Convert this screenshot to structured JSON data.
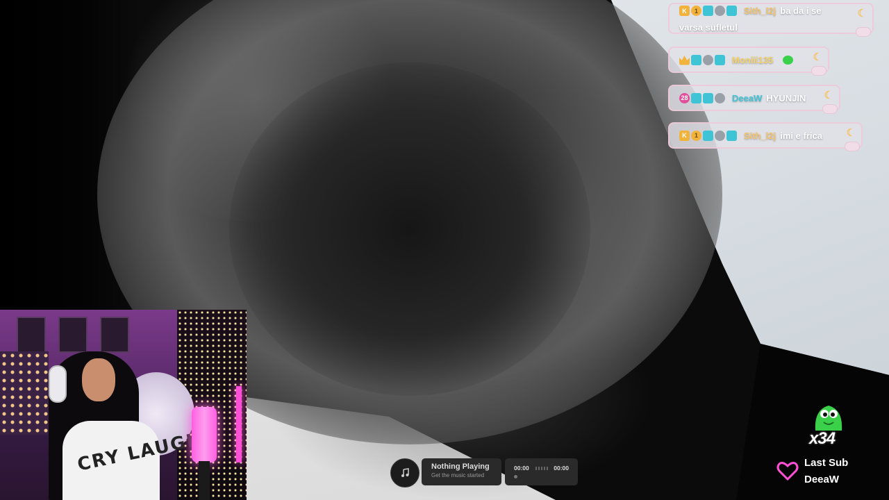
{
  "chat": {
    "messages": [
      {
        "user": "Sith_l2j",
        "text": "ba da i se",
        "text2": "varsa sufletul",
        "name_color": "#f5c46a"
      },
      {
        "user": "Moniii135",
        "text": "",
        "name_color": "#f5d26a",
        "emote": "frog-emote"
      },
      {
        "user": "DeeaW",
        "text": "HYUNJIN",
        "name_color": "#3fc4d6",
        "badge_number": "28"
      },
      {
        "user": "Sith_l2j",
        "text": "imi e frica",
        "name_color": "#f5c46a"
      }
    ]
  },
  "music": {
    "title": "Nothing Playing",
    "subtitle": "Get the music started",
    "time_current": "00:00",
    "time_total": "00:00"
  },
  "sub_alert": {
    "multiplier": "x34",
    "label": "Last Sub",
    "name": "DeeaW"
  },
  "webcam": {
    "shirt_text": "CRY LAUGH"
  },
  "colors": {
    "chat_border": "#f0c8d7",
    "accent_pink": "#ff4fd6",
    "mascot_green": "#3ad04a"
  }
}
